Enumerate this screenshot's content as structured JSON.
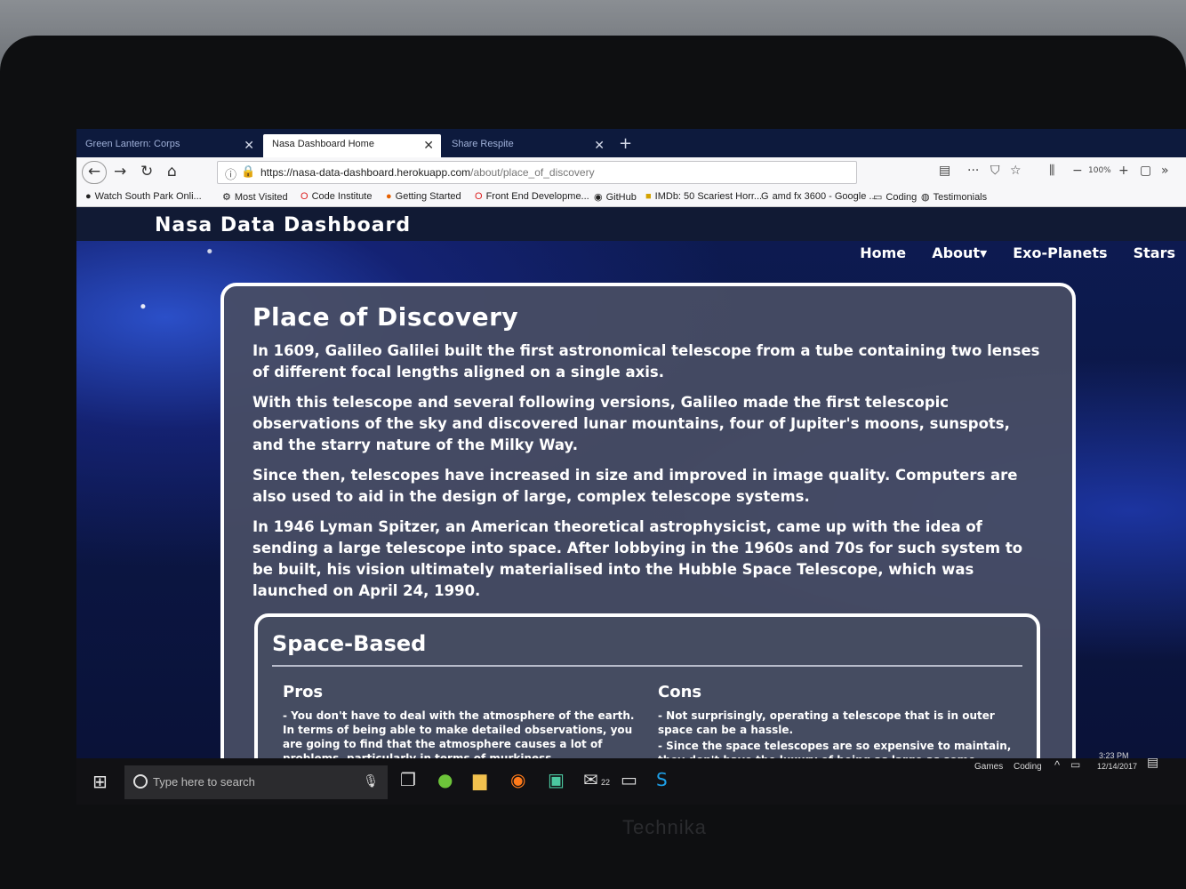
{
  "browser": {
    "tabs": [
      {
        "label": "Green Lantern: Corps",
        "active": false
      },
      {
        "label": "Nasa Dashboard Home",
        "active": true
      },
      {
        "label": "Share Respite",
        "active": false
      }
    ],
    "url": "https://nasa-data-dashboard.herokuapp.com",
    "url_path": "/about/place_of_discovery",
    "zoom": "100%",
    "bookmarks": [
      "Watch South Park Onli...",
      "Most Visited",
      "Code Institute",
      "Getting Started",
      "Front End Developme...",
      "GitHub",
      "IMDb: 50 Scariest Horr...",
      "amd fx 3600 - Google ...",
      "Coding",
      "Testimonials"
    ]
  },
  "site": {
    "title": "Nasa Data Dashboard",
    "nav": [
      "Home",
      "About▾",
      "Exo-Planets",
      "Stars"
    ]
  },
  "article": {
    "heading": "Place of Discovery",
    "paragraphs": [
      "In 1609, Galileo Galilei built the first astronomical telescope from a tube containing two lenses of different focal lengths aligned on a single axis.",
      "With this telescope and several following versions, Galileo made the first telescopic observations of the sky and discovered lunar mountains, four of Jupiter's moons, sunspots, and the starry nature of the Milky Way.",
      "Since then, telescopes have increased in size and improved in image quality. Computers are also used to aid in the design of large, complex telescope systems.",
      "In 1946 Lyman Spitzer, an American theoretical astrophysicist, came up with the idea of sending a large telescope into space. After lobbying in the 1960s and 70s for such system to be built, his vision ultimately materialised into the Hubble Space Telescope, which was launched on April 24, 1990."
    ],
    "section": {
      "heading": "Space-Based",
      "pros_heading": "Pros",
      "pros": [
        "- You don't have to deal with the atmosphere of the earth. In terms of being able to make detailed observations, you are going to find that the atmosphere causes a lot of problems, particularly in terms of murkiness"
      ],
      "cons_heading": "Cons",
      "cons": [
        "- Not surprisingly, operating a telescope that is in outer space can be a hassle.",
        "- Since the space telescopes are so expensive to maintain, they don't have the luxury of being as large as some would like it to be"
      ]
    }
  },
  "taskbar": {
    "search_placeholder": "Type here to search",
    "tray_items": [
      "Games",
      "Coding"
    ],
    "time": "3:23 PM",
    "date": "12/14/2017",
    "mail_badge": "22"
  },
  "monitor": {
    "brand": "Technika"
  }
}
